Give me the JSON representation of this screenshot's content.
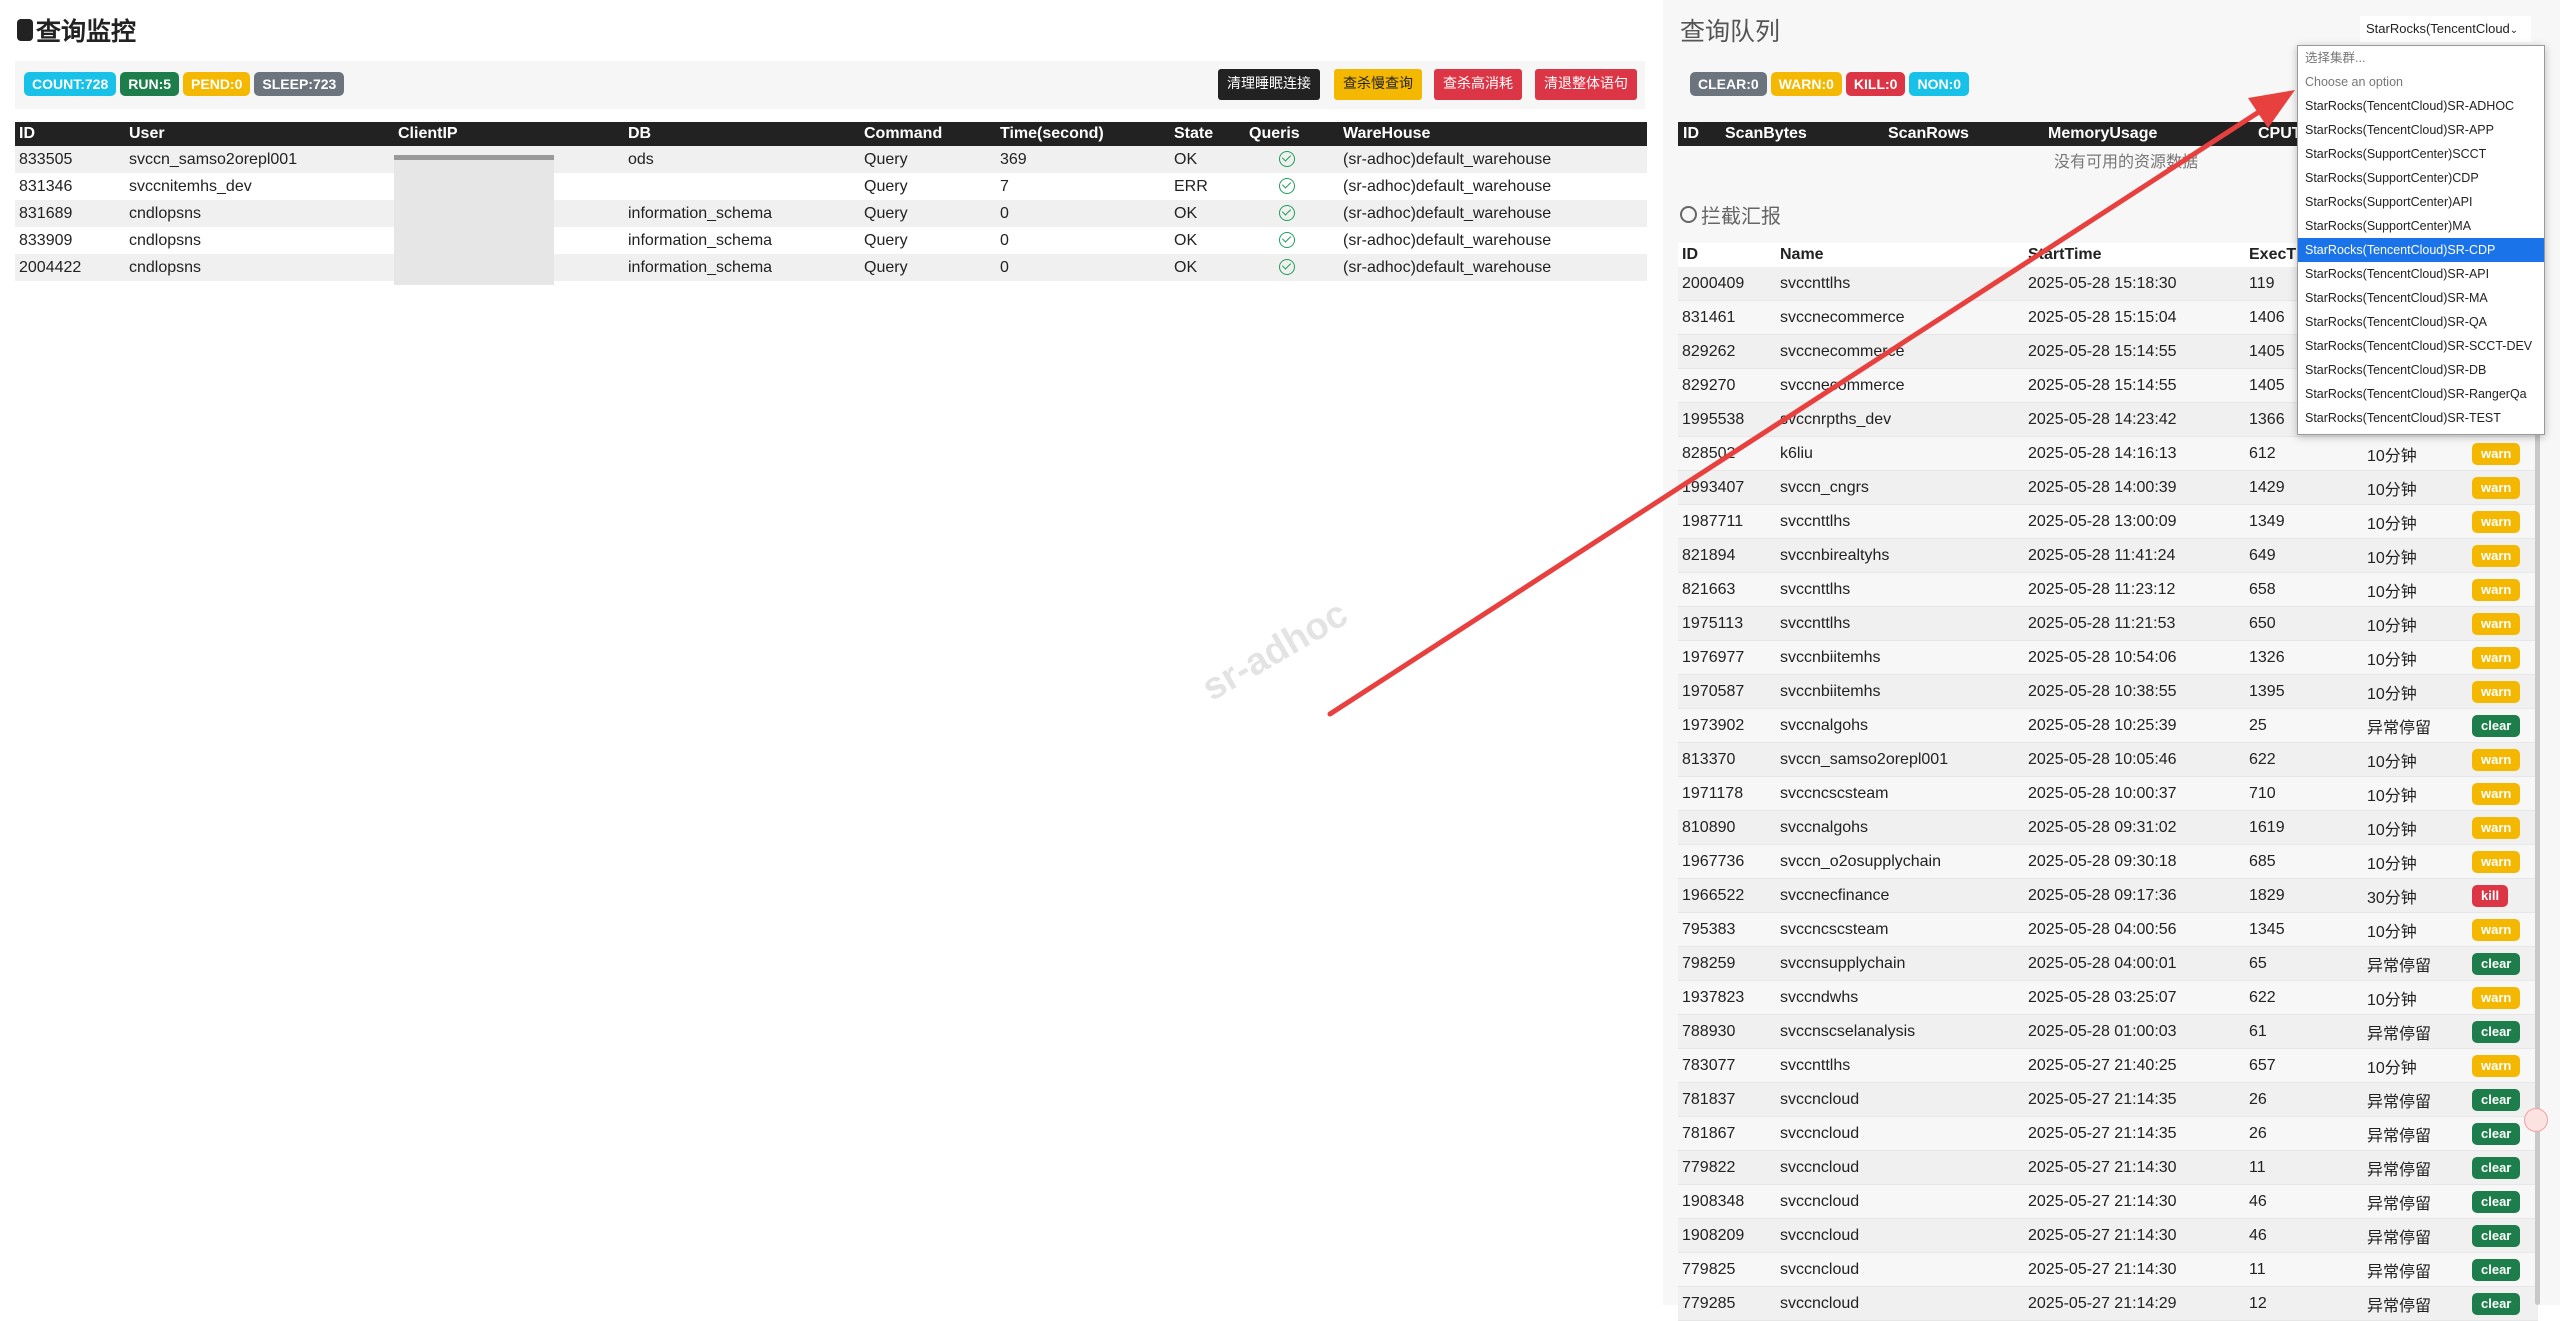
{
  "monitor": {
    "title": "查询监控",
    "badges": [
      "COUNT:728",
      "RUN:5",
      "PEND:0",
      "SLEEP:723"
    ],
    "buttons": [
      "清理睡眠连接",
      "查杀慢查询",
      "查杀高消耗",
      "清退整体语句"
    ],
    "columns": [
      "ID",
      "User",
      "ClientIP",
      "DB",
      "Command",
      "Time(second)",
      "State",
      "Queris",
      "WareHouse"
    ],
    "rows": [
      {
        "id": "833505",
        "user": "svccn_samso2orepl001",
        "db": "ods",
        "command": "Query",
        "time": "369",
        "state": "OK",
        "warehouse": "(sr-adhoc)default_warehouse"
      },
      {
        "id": "831346",
        "user": "svccnitemhs_dev",
        "db": "",
        "command": "Query",
        "time": "7",
        "state": "ERR",
        "warehouse": "(sr-adhoc)default_warehouse"
      },
      {
        "id": "831689",
        "user": "cndlopsns",
        "db": "information_schema",
        "command": "Query",
        "time": "0",
        "state": "OK",
        "warehouse": "(sr-adhoc)default_warehouse"
      },
      {
        "id": "833909",
        "user": "cndlopsns",
        "db": "information_schema",
        "command": "Query",
        "time": "0",
        "state": "OK",
        "warehouse": "(sr-adhoc)default_warehouse"
      },
      {
        "id": "2004422",
        "user": "cndlopsns",
        "db": "information_schema",
        "command": "Query",
        "time": "0",
        "state": "OK",
        "warehouse": "(sr-adhoc)default_warehouse"
      }
    ]
  },
  "watermark": "sr-adhoc",
  "queue": {
    "title": "查询队列",
    "select_value": "StarRocks(TencentCloud",
    "badges": [
      "CLEAR:0",
      "WARN:0",
      "KILL:0",
      "NON:0"
    ],
    "columns": [
      "ID",
      "ScanBytes",
      "ScanRows",
      "MemoryUsage",
      "CPUT"
    ],
    "empty_text": "没有可用的资源数据"
  },
  "intercept": {
    "title": "拦截汇报",
    "columns": [
      "ID",
      "Name",
      "StartTime",
      "ExecTi"
    ],
    "rows": [
      {
        "id": "2000409",
        "name": "svccnttlhs",
        "start": "2025-05-28 15:18:30",
        "exec": "119",
        "dur": "",
        "tag": ""
      },
      {
        "id": "831461",
        "name": "svccnecommerce",
        "start": "2025-05-28 15:15:04",
        "exec": "1406",
        "dur": "",
        "tag": ""
      },
      {
        "id": "829262",
        "name": "svccnecommerce",
        "start": "2025-05-28 15:14:55",
        "exec": "1405",
        "dur": "",
        "tag": ""
      },
      {
        "id": "829270",
        "name": "svccnecommerce",
        "start": "2025-05-28 15:14:55",
        "exec": "1405",
        "dur": "",
        "tag": ""
      },
      {
        "id": "1995538",
        "name": "svccnrpths_dev",
        "start": "2025-05-28 14:23:42",
        "exec": "1366",
        "dur": "",
        "tag": ""
      },
      {
        "id": "828502",
        "name": "k6liu",
        "start": "2025-05-28 14:16:13",
        "exec": "612",
        "dur": "10分钟",
        "tag": "warn"
      },
      {
        "id": "1993407",
        "name": "svccn_cngrs",
        "start": "2025-05-28 14:00:39",
        "exec": "1429",
        "dur": "10分钟",
        "tag": "warn"
      },
      {
        "id": "1987711",
        "name": "svccnttlhs",
        "start": "2025-05-28 13:00:09",
        "exec": "1349",
        "dur": "10分钟",
        "tag": "warn"
      },
      {
        "id": "821894",
        "name": "svccnbirealtyhs",
        "start": "2025-05-28 11:41:24",
        "exec": "649",
        "dur": "10分钟",
        "tag": "warn"
      },
      {
        "id": "821663",
        "name": "svccnttlhs",
        "start": "2025-05-28 11:23:12",
        "exec": "658",
        "dur": "10分钟",
        "tag": "warn"
      },
      {
        "id": "1975113",
        "name": "svccnttlhs",
        "start": "2025-05-28 11:21:53",
        "exec": "650",
        "dur": "10分钟",
        "tag": "warn"
      },
      {
        "id": "1976977",
        "name": "svccnbiitemhs",
        "start": "2025-05-28 10:54:06",
        "exec": "1326",
        "dur": "10分钟",
        "tag": "warn"
      },
      {
        "id": "1970587",
        "name": "svccnbiitemhs",
        "start": "2025-05-28 10:38:55",
        "exec": "1395",
        "dur": "10分钟",
        "tag": "warn"
      },
      {
        "id": "1973902",
        "name": "svccnalgohs",
        "start": "2025-05-28 10:25:39",
        "exec": "25",
        "dur": "异常停留",
        "tag": "clear"
      },
      {
        "id": "813370",
        "name": "svccn_samso2orepl001",
        "start": "2025-05-28 10:05:46",
        "exec": "622",
        "dur": "10分钟",
        "tag": "warn"
      },
      {
        "id": "1971178",
        "name": "svccncscsteam",
        "start": "2025-05-28 10:00:37",
        "exec": "710",
        "dur": "10分钟",
        "tag": "warn"
      },
      {
        "id": "810890",
        "name": "svccnalgohs",
        "start": "2025-05-28 09:31:02",
        "exec": "1619",
        "dur": "10分钟",
        "tag": "warn"
      },
      {
        "id": "1967736",
        "name": "svccn_o2osupplychain",
        "start": "2025-05-28 09:30:18",
        "exec": "685",
        "dur": "10分钟",
        "tag": "warn"
      },
      {
        "id": "1966522",
        "name": "svccnecfinance",
        "start": "2025-05-28 09:17:36",
        "exec": "1829",
        "dur": "30分钟",
        "tag": "kill"
      },
      {
        "id": "795383",
        "name": "svccncscsteam",
        "start": "2025-05-28 04:00:56",
        "exec": "1345",
        "dur": "10分钟",
        "tag": "warn"
      },
      {
        "id": "798259",
        "name": "svccnsupplychain",
        "start": "2025-05-28 04:00:01",
        "exec": "65",
        "dur": "异常停留",
        "tag": "clear"
      },
      {
        "id": "1937823",
        "name": "svccndwhs",
        "start": "2025-05-28 03:25:07",
        "exec": "622",
        "dur": "10分钟",
        "tag": "warn"
      },
      {
        "id": "788930",
        "name": "svccnscselanalysis",
        "start": "2025-05-28 01:00:03",
        "exec": "61",
        "dur": "异常停留",
        "tag": "clear"
      },
      {
        "id": "783077",
        "name": "svccnttlhs",
        "start": "2025-05-27 21:40:25",
        "exec": "657",
        "dur": "10分钟",
        "tag": "warn"
      },
      {
        "id": "781837",
        "name": "svccncloud",
        "start": "2025-05-27 21:14:35",
        "exec": "26",
        "dur": "异常停留",
        "tag": "clear"
      },
      {
        "id": "781867",
        "name": "svccncloud",
        "start": "2025-05-27 21:14:35",
        "exec": "26",
        "dur": "异常停留",
        "tag": "clear"
      },
      {
        "id": "779822",
        "name": "svccncloud",
        "start": "2025-05-27 21:14:30",
        "exec": "11",
        "dur": "异常停留",
        "tag": "clear"
      },
      {
        "id": "1908348",
        "name": "svccncloud",
        "start": "2025-05-27 21:14:30",
        "exec": "46",
        "dur": "异常停留",
        "tag": "clear"
      },
      {
        "id": "1908209",
        "name": "svccncloud",
        "start": "2025-05-27 21:14:30",
        "exec": "46",
        "dur": "异常停留",
        "tag": "clear"
      },
      {
        "id": "779825",
        "name": "svccncloud",
        "start": "2025-05-27 21:14:30",
        "exec": "11",
        "dur": "异常停留",
        "tag": "clear"
      },
      {
        "id": "779285",
        "name": "svccncloud",
        "start": "2025-05-27 21:14:29",
        "exec": "12",
        "dur": "异常停留",
        "tag": "clear"
      }
    ]
  },
  "dropdown": {
    "options": [
      "选择集群...",
      "Choose an option",
      "StarRocks(TencentCloud)SR-ADHOC",
      "StarRocks(TencentCloud)SR-APP",
      "StarRocks(SupportCenter)SCCT",
      "StarRocks(SupportCenter)CDP",
      "StarRocks(SupportCenter)API",
      "StarRocks(SupportCenter)MA",
      "StarRocks(TencentCloud)SR-CDP",
      "StarRocks(TencentCloud)SR-API",
      "StarRocks(TencentCloud)SR-MA",
      "StarRocks(TencentCloud)SR-QA",
      "StarRocks(TencentCloud)SR-SCCT-DEV",
      "StarRocks(TencentCloud)SR-DB",
      "StarRocks(TencentCloud)SR-RangerQa",
      "StarRocks(TencentCloud)SR-TEST"
    ],
    "selected": "StarRocks(TencentCloud)SR-CDP"
  },
  "colors": {
    "cyan": "#17c1e8",
    "green": "#1e7e4b",
    "yellow": "#f5b800",
    "gray": "#6c757d",
    "red": "#dc3545",
    "arrow": "#e8403e"
  }
}
